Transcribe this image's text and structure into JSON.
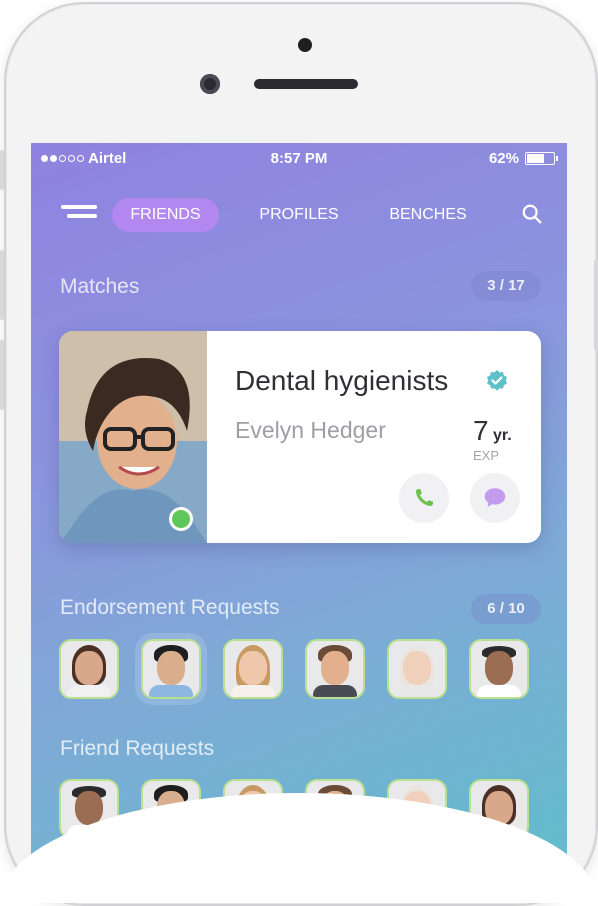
{
  "status_bar": {
    "carrier": "Airtel",
    "time": "8:57 PM",
    "battery": "62%",
    "battery_level": 0.62
  },
  "nav": {
    "tabs": [
      {
        "label": "FRIENDS",
        "active": true
      },
      {
        "label": "PROFILES"
      },
      {
        "label": "BENCHES"
      }
    ]
  },
  "matches": {
    "title": "Matches",
    "count": "3 / 17",
    "card": {
      "job_title": "Dental hygienists",
      "name": "Evelyn Hedger",
      "experience_value": "7",
      "experience_unit": "yr.",
      "experience_label": "EXP"
    }
  },
  "endorsements": {
    "title": "Endorsement Requests",
    "count": "6 / 10"
  },
  "friend_requests": {
    "title": "Friend Requests"
  },
  "colors": {
    "accent_tab": "#b387f0",
    "online": "#5fc65a",
    "call_green": "#6cc24a",
    "chat_purple": "#c39cf0",
    "verified": "#5ec1c8"
  },
  "icons": [
    "menu-icon",
    "search-icon",
    "verified-icon",
    "phone-icon",
    "chat-icon"
  ]
}
